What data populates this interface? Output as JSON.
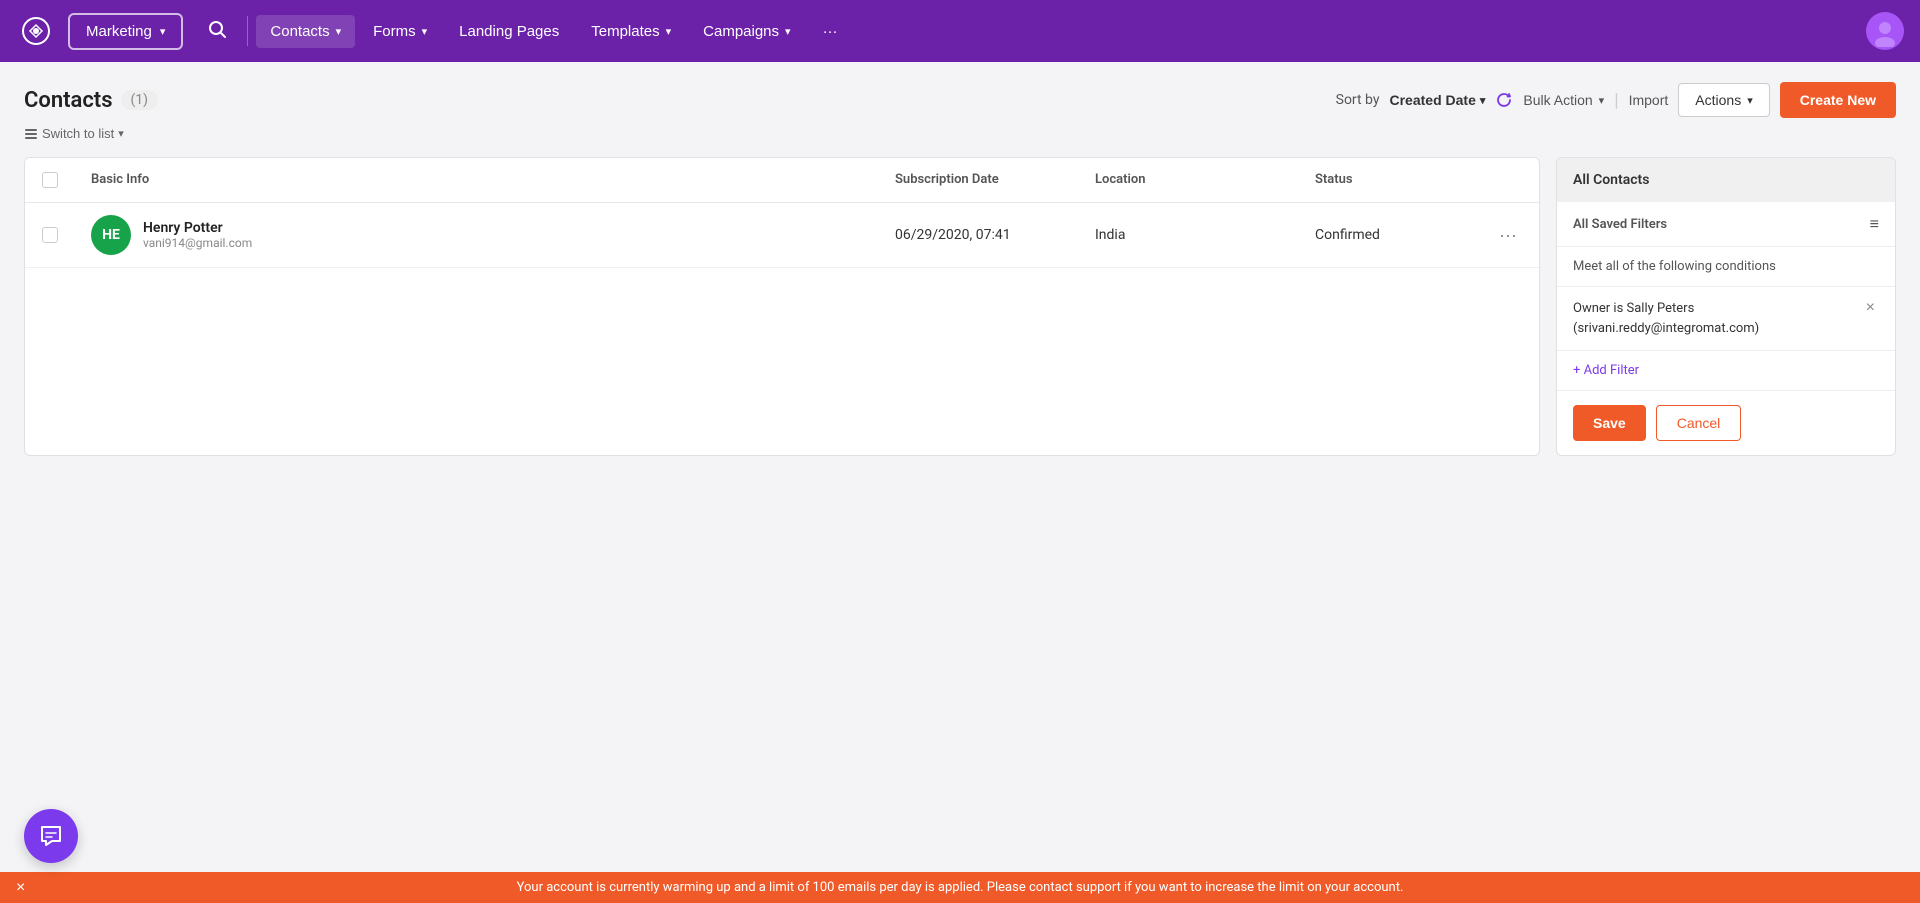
{
  "nav": {
    "logo_label": "Marketing Platform",
    "marketing_label": "Marketing",
    "search_icon": "search",
    "items": [
      {
        "label": "Contacts",
        "has_dropdown": true,
        "active": true
      },
      {
        "label": "Forms",
        "has_dropdown": true
      },
      {
        "label": "Landing Pages",
        "has_dropdown": false
      },
      {
        "label": "Templates",
        "has_dropdown": true
      },
      {
        "label": "Campaigns",
        "has_dropdown": true
      },
      {
        "label": "···",
        "has_dropdown": false
      }
    ]
  },
  "page": {
    "title": "Contacts",
    "count": "(1)",
    "sort_label": "Sort by",
    "sort_value": "Created Date",
    "switch_list": "Switch to list",
    "bulk_action": "Bulk Action",
    "import": "Import",
    "actions": "Actions",
    "create_new": "Create New"
  },
  "table": {
    "headers": [
      "",
      "Basic Info",
      "Subscription Date",
      "Location",
      "Status",
      ""
    ],
    "rows": [
      {
        "initials": "HE",
        "name": "Henry Potter",
        "email": "vani914@gmail.com",
        "subscription_date": "06/29/2020, 07:41",
        "location": "India",
        "status": "Confirmed"
      }
    ]
  },
  "filter_panel": {
    "title": "All Contacts",
    "saved_filters_label": "All Saved Filters",
    "meet_text": "Meet all of the following conditions",
    "condition_label": "Owner is Sally Peters",
    "condition_sub": "(srivani.reddy@integromat.com)",
    "add_filter": "+ Add Filter",
    "save_btn": "Save",
    "cancel_btn": "Cancel"
  },
  "chat_widget": {
    "icon": "chat"
  },
  "bottom_banner": {
    "text": "Your account is currently warming up and a limit of 100 emails per day is applied. Please contact support if you want to increase the limit on your account.",
    "close": "×"
  }
}
